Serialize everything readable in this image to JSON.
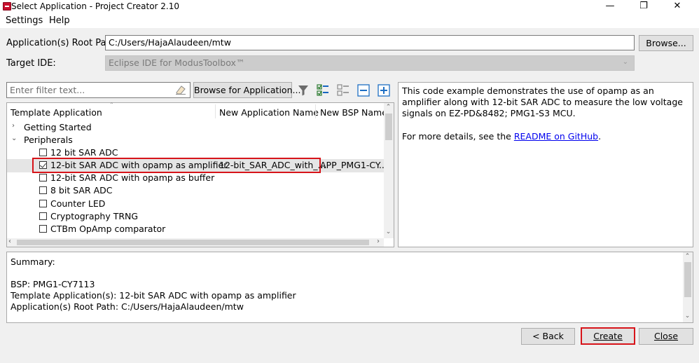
{
  "window": {
    "title": "Select Application - Project Creator 2.10",
    "minimize": "—",
    "restore": "❐",
    "close": "✕"
  },
  "menu": {
    "settings": "Settings",
    "help": "Help"
  },
  "form": {
    "root_path_label": "Application(s) Root Path:",
    "root_path_value": "C:/Users/HajaAlaudeen/mtw",
    "browse_label": "Browse...",
    "target_ide_label": "Target IDE:",
    "target_ide_value": "Eclipse IDE for ModusToolbox™"
  },
  "filter": {
    "placeholder": "Enter filter text...",
    "browse_label": "Browse for Application..."
  },
  "tree": {
    "columns": [
      "Template Application",
      "New Application Name",
      "New BSP Name"
    ],
    "groups": [
      {
        "label": "Getting Started",
        "expanded": false
      },
      {
        "label": "Peripherals",
        "expanded": true
      }
    ],
    "items": [
      {
        "label": "12 bit SAR ADC",
        "checked": false
      },
      {
        "label": "12-bit SAR ADC with opamp as amplifier",
        "checked": true,
        "app_name": "12-bit_SAR_ADC_with_...",
        "bsp_name": "APP_PMG1-CY..."
      },
      {
        "label": "12-bit SAR ADC with opamp as buffer",
        "checked": false
      },
      {
        "label": "8 bit SAR ADC",
        "checked": false
      },
      {
        "label": "Counter LED",
        "checked": false
      },
      {
        "label": "Cryptography TRNG",
        "checked": false
      },
      {
        "label": "CTBm OpAmp comparator",
        "checked": false
      }
    ]
  },
  "description": {
    "text": "This code example demonstrates the use of opamp as an amplifier along with 12-bit SAR ADC to measure the low voltage signals on EZ-PD&8482; PMG1-S3 MCU.",
    "more_prefix": "For more details, see the ",
    "link": "README on GitHub",
    "more_suffix": "."
  },
  "summary": {
    "title": "Summary:",
    "bsp": "BSP: PMG1-CY7113",
    "template": "Template Application(s): 12-bit SAR ADC with opamp as amplifier",
    "root": "Application(s) Root Path: C:/Users/HajaAlaudeen/mtw"
  },
  "buttons": {
    "back": "< Back",
    "create": "Create",
    "close": "Close"
  },
  "colors": {
    "highlight": "#d7141a",
    "link": "#0000ee"
  }
}
